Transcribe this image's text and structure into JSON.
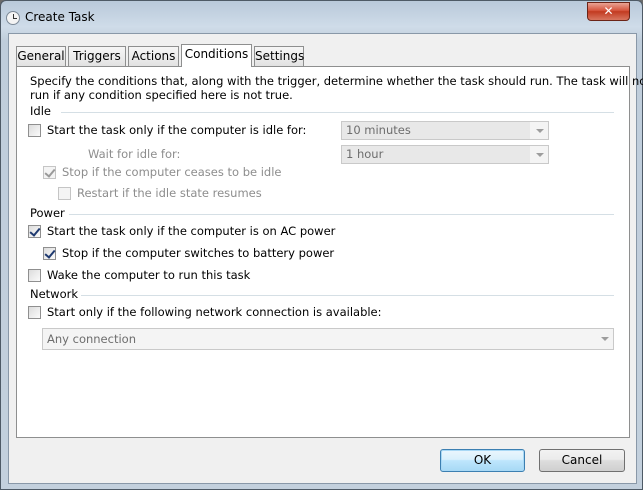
{
  "window": {
    "title": "Create Task",
    "close_glyph": "✕"
  },
  "tabs": [
    {
      "label": "General"
    },
    {
      "label": "Triggers"
    },
    {
      "label": "Actions"
    },
    {
      "label": "Conditions",
      "active": true
    },
    {
      "label": "Settings"
    }
  ],
  "conditions": {
    "description_line1": "Specify the conditions that, along with the trigger, determine whether the task should run.  The task will not",
    "description_line2": "run  if any condition specified here is not true.",
    "idle": {
      "group_label": "Idle",
      "start_if_idle": {
        "label": "Start the task only if the computer is idle for:",
        "checked": false
      },
      "idle_duration": {
        "value": "10 minutes"
      },
      "wait_label": "Wait for idle for:",
      "wait_duration": {
        "value": "1 hour"
      },
      "stop_if_ceases": {
        "label": "Stop if the computer ceases to be idle",
        "checked": true,
        "disabled": true
      },
      "restart_if_resumes": {
        "label": "Restart if the idle state resumes",
        "checked": false,
        "disabled": true
      }
    },
    "power": {
      "group_label": "Power",
      "start_on_ac": {
        "label": "Start the task only if the computer is on AC power",
        "checked": true
      },
      "stop_on_battery": {
        "label": "Stop if the computer switches to battery power",
        "checked": true
      },
      "wake_to_run": {
        "label": "Wake the computer to run this task",
        "checked": false
      }
    },
    "network": {
      "group_label": "Network",
      "start_if_network": {
        "label": "Start only if the following network connection is available:",
        "checked": false
      },
      "connection": {
        "value": "Any connection"
      }
    }
  },
  "buttons": {
    "ok": "OK",
    "cancel": "Cancel"
  }
}
